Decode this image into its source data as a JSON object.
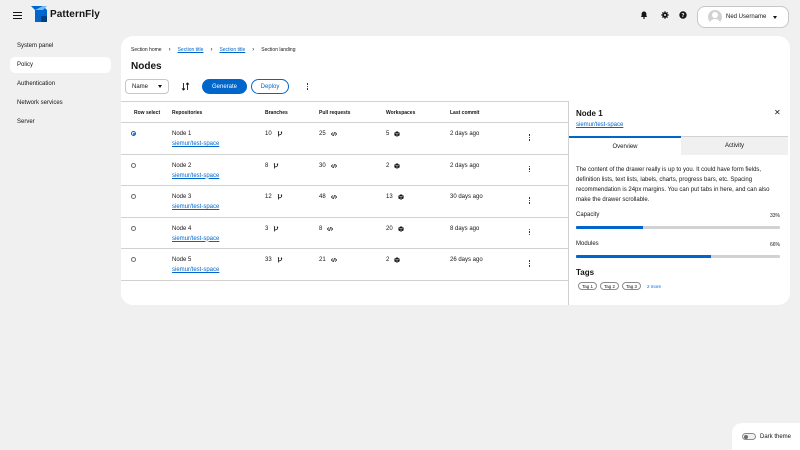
{
  "brand": {
    "name": "PatternFly"
  },
  "header": {
    "user_name": "Ned Username",
    "icons": [
      "bell-icon",
      "gear-icon",
      "help-icon"
    ]
  },
  "sidebar": {
    "items": [
      {
        "label": "System panel",
        "active": false
      },
      {
        "label": "Policy",
        "active": true
      },
      {
        "label": "Authentication",
        "active": false
      },
      {
        "label": "Network services",
        "active": false
      },
      {
        "label": "Server",
        "active": false
      }
    ]
  },
  "breadcrumb": [
    "Section home",
    "Section title",
    "Section title",
    "Section landing"
  ],
  "page_title": "Nodes",
  "toolbar": {
    "select_value": "Name",
    "generate_label": "Generate",
    "deploy_label": "Deploy"
  },
  "table": {
    "headers": [
      "Row select",
      "Repositories",
      "Branches",
      "Pull requests",
      "Workspaces",
      "Last commit"
    ],
    "rows": [
      {
        "name": "Node 1",
        "link": "siemur/test-space",
        "branches": "10",
        "pulls": "25",
        "workspaces": "5",
        "commit": "2 days ago",
        "selected": true
      },
      {
        "name": "Node 2",
        "link": "siemur/test-space",
        "branches": "8",
        "pulls": "30",
        "workspaces": "2",
        "commit": "2 days ago",
        "selected": false
      },
      {
        "name": "Node 3",
        "link": "siemur/test-space",
        "branches": "12",
        "pulls": "48",
        "workspaces": "13",
        "commit": "30 days ago",
        "selected": false
      },
      {
        "name": "Node 4",
        "link": "siemur/test-space",
        "branches": "3",
        "pulls": "8",
        "workspaces": "20",
        "commit": "8 days ago",
        "selected": false
      },
      {
        "name": "Node 5",
        "link": "siemur/test-space",
        "branches": "33",
        "pulls": "21",
        "workspaces": "2",
        "commit": "26 days ago",
        "selected": false
      }
    ]
  },
  "drawer": {
    "title": "Node 1",
    "link": "siemur/test-space",
    "tabs": [
      "Overview",
      "Activity"
    ],
    "body": "The content of the drawer really is up to you. It could have form fields, definition lists, text lists, labels, charts, progress bars, etc. Spacing recommendation is 24px margins. You can put tabs in here, and can also make the drawer scrollable.",
    "progress": [
      {
        "label": "Capacity",
        "value_text": "33%",
        "value": 0.33
      },
      {
        "label": "Modules",
        "value_text": "66%",
        "value": 0.66
      }
    ],
    "tags_title": "Tags",
    "tags": [
      "Tag 1",
      "Tag 2",
      "Tag 3"
    ],
    "more_label": "2 more",
    "close_symbol": "✕"
  },
  "theme": {
    "label": "Dark theme",
    "enabled": false
  },
  "colors": {
    "accent": "#0066cc",
    "background": "#f0f0f0",
    "surface": "#ffffff"
  }
}
